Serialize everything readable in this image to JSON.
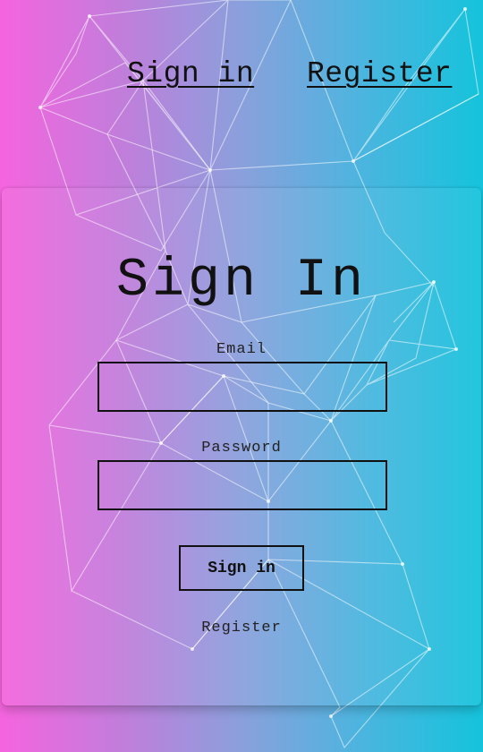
{
  "nav": {
    "signin_label": "Sign in",
    "register_label": "Register"
  },
  "form": {
    "title": "Sign In",
    "email_label": "Email",
    "email_value": "",
    "password_label": "Password",
    "password_value": "",
    "submit_label": "Sign in",
    "register_link": "Register"
  },
  "colors": {
    "gradient_left": "#f564de",
    "gradient_right": "#15c3dc",
    "text": "#111111"
  }
}
